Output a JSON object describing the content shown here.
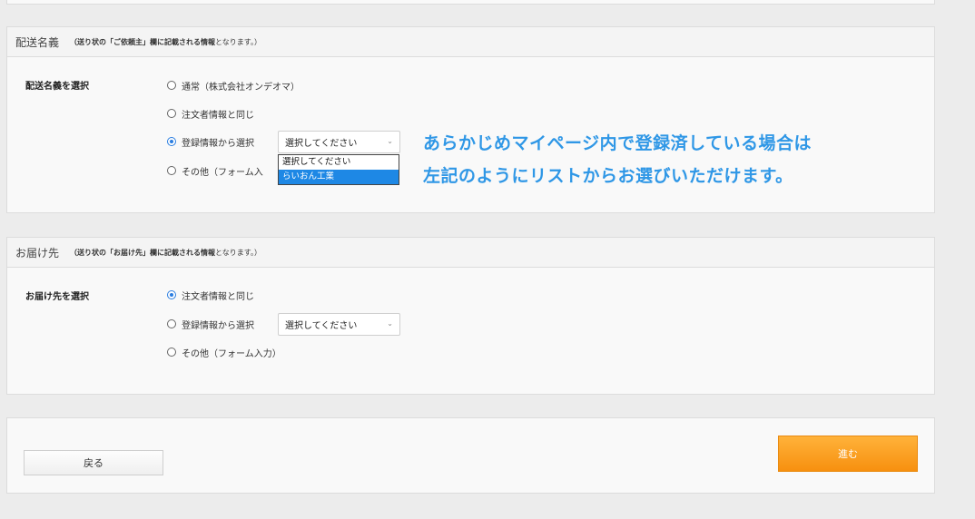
{
  "sender_section": {
    "title": "配送名義",
    "note_bold": "（送り状の「ご依頼主」欄に記載される情報",
    "note_tail": "となります。）",
    "field_label": "配送名義を選択",
    "options": [
      {
        "label": "通常（株式会社オンデオマ）",
        "checked": false
      },
      {
        "label": "注文者情報と同じ",
        "checked": false
      },
      {
        "label": "登録情報から選択",
        "checked": true
      },
      {
        "label": "その他（フォーム入",
        "checked": false
      }
    ],
    "select_value": "選択してください",
    "dropdown_items": [
      "選択してください",
      "らいおん工業"
    ],
    "dropdown_selected_index": 1
  },
  "callout": {
    "line1": "あらかじめマイページ内で登録済している場合は",
    "line2": "左記のようにリストからお選びいただけます。"
  },
  "delivery_section": {
    "title": "お届け先",
    "note_bold": "（送り状の「お届け先」欄に記載される情報",
    "note_tail": "となります。）",
    "field_label": "お届け先を選択",
    "options": [
      {
        "label": "注文者情報と同じ",
        "checked": true
      },
      {
        "label": "登録情報から選択",
        "checked": false
      },
      {
        "label": "その他（フォーム入力）",
        "checked": false
      }
    ],
    "select_value": "選択してください"
  },
  "footer": {
    "back_label": "戻る",
    "next_label": "進む"
  },
  "colors": {
    "accent_blue": "#2f97e6",
    "radio_blue": "#2a7de0",
    "button_orange": "#f7900f"
  }
}
